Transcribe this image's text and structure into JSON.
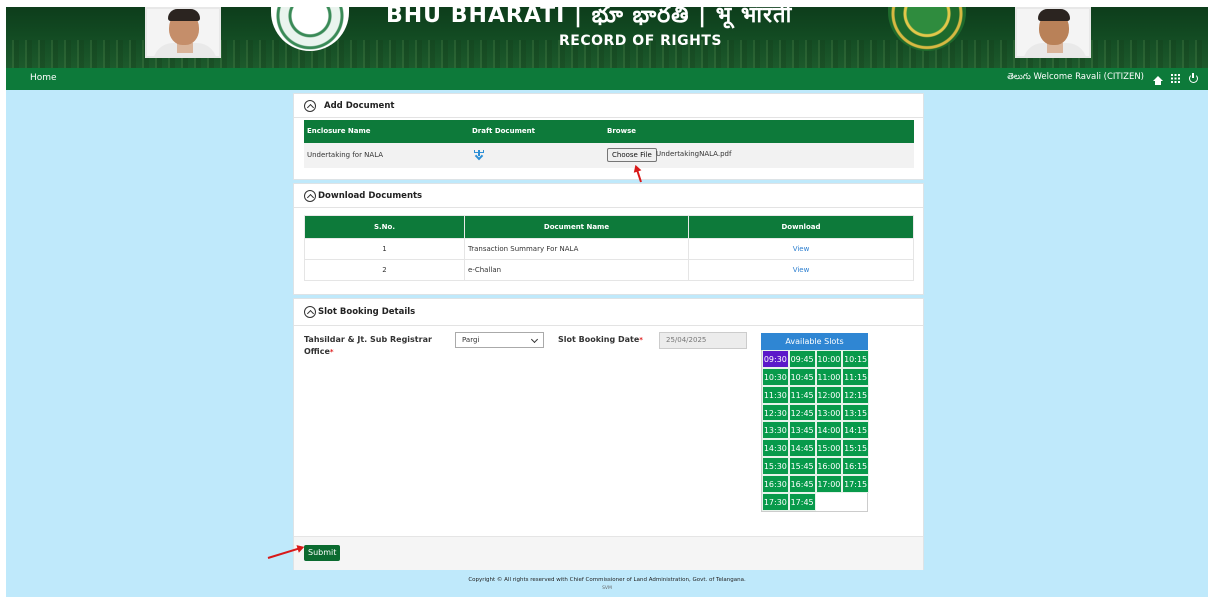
{
  "header": {
    "title_top": "BHU BHARATI | భూ భారతి | भू भारती",
    "title": "RECORD OF RIGHTS"
  },
  "navbar": {
    "home": "Home",
    "language": "తెలుగు",
    "welcome": "Welcome",
    "user": "Ravali (CITIZEN)"
  },
  "add_document": {
    "title": "Add Document",
    "columns": [
      "Enclosure Name",
      "Draft Document",
      "Browse"
    ],
    "row": {
      "enclosure_name": "Undertaking for NALA",
      "browse_button": "Choose File",
      "file_name": "UndertakingNALA.pdf"
    }
  },
  "download_documents": {
    "title": "Download Documents",
    "columns": [
      "S.No.",
      "Document Name",
      "Download"
    ],
    "rows": [
      {
        "sno": "1",
        "name": "Transaction Summary For NALA",
        "action": "View"
      },
      {
        "sno": "2",
        "name": "e-Challan",
        "action": "View"
      }
    ]
  },
  "slot_booking": {
    "title": "Slot Booking Details",
    "office_label": "Tahsildar & Jt. Sub Registrar Office",
    "office_value": "Pargi",
    "date_label": "Slot Booking Date",
    "date_value": "25/04/2025",
    "slots_title": "Available Slots",
    "selected_slot": "09:30",
    "slots": [
      "09:30",
      "09:45",
      "10:00",
      "10:15",
      "10:30",
      "10:45",
      "11:00",
      "11:15",
      "11:30",
      "11:45",
      "12:00",
      "12:15",
      "12:30",
      "12:45",
      "13:00",
      "13:15",
      "13:30",
      "13:45",
      "14:00",
      "14:15",
      "14:30",
      "14:45",
      "15:00",
      "15:15",
      "15:30",
      "15:45",
      "16:00",
      "16:15",
      "16:30",
      "16:45",
      "17:00",
      "17:15",
      "17:30",
      "17:45"
    ]
  },
  "actions": {
    "submit": "Submit"
  },
  "footer": {
    "copyright": "Copyright © All rights reserved with Chief Commissioner of Land Administration, Govt. of Telangana.",
    "sub": "SVM"
  },
  "colors": {
    "primary_green": "#0d7a3a",
    "slot_green": "#089a4b",
    "selected_slot": "#5b18c9",
    "slots_header": "#2f86d3",
    "page_bg": "#bfe9fb"
  }
}
